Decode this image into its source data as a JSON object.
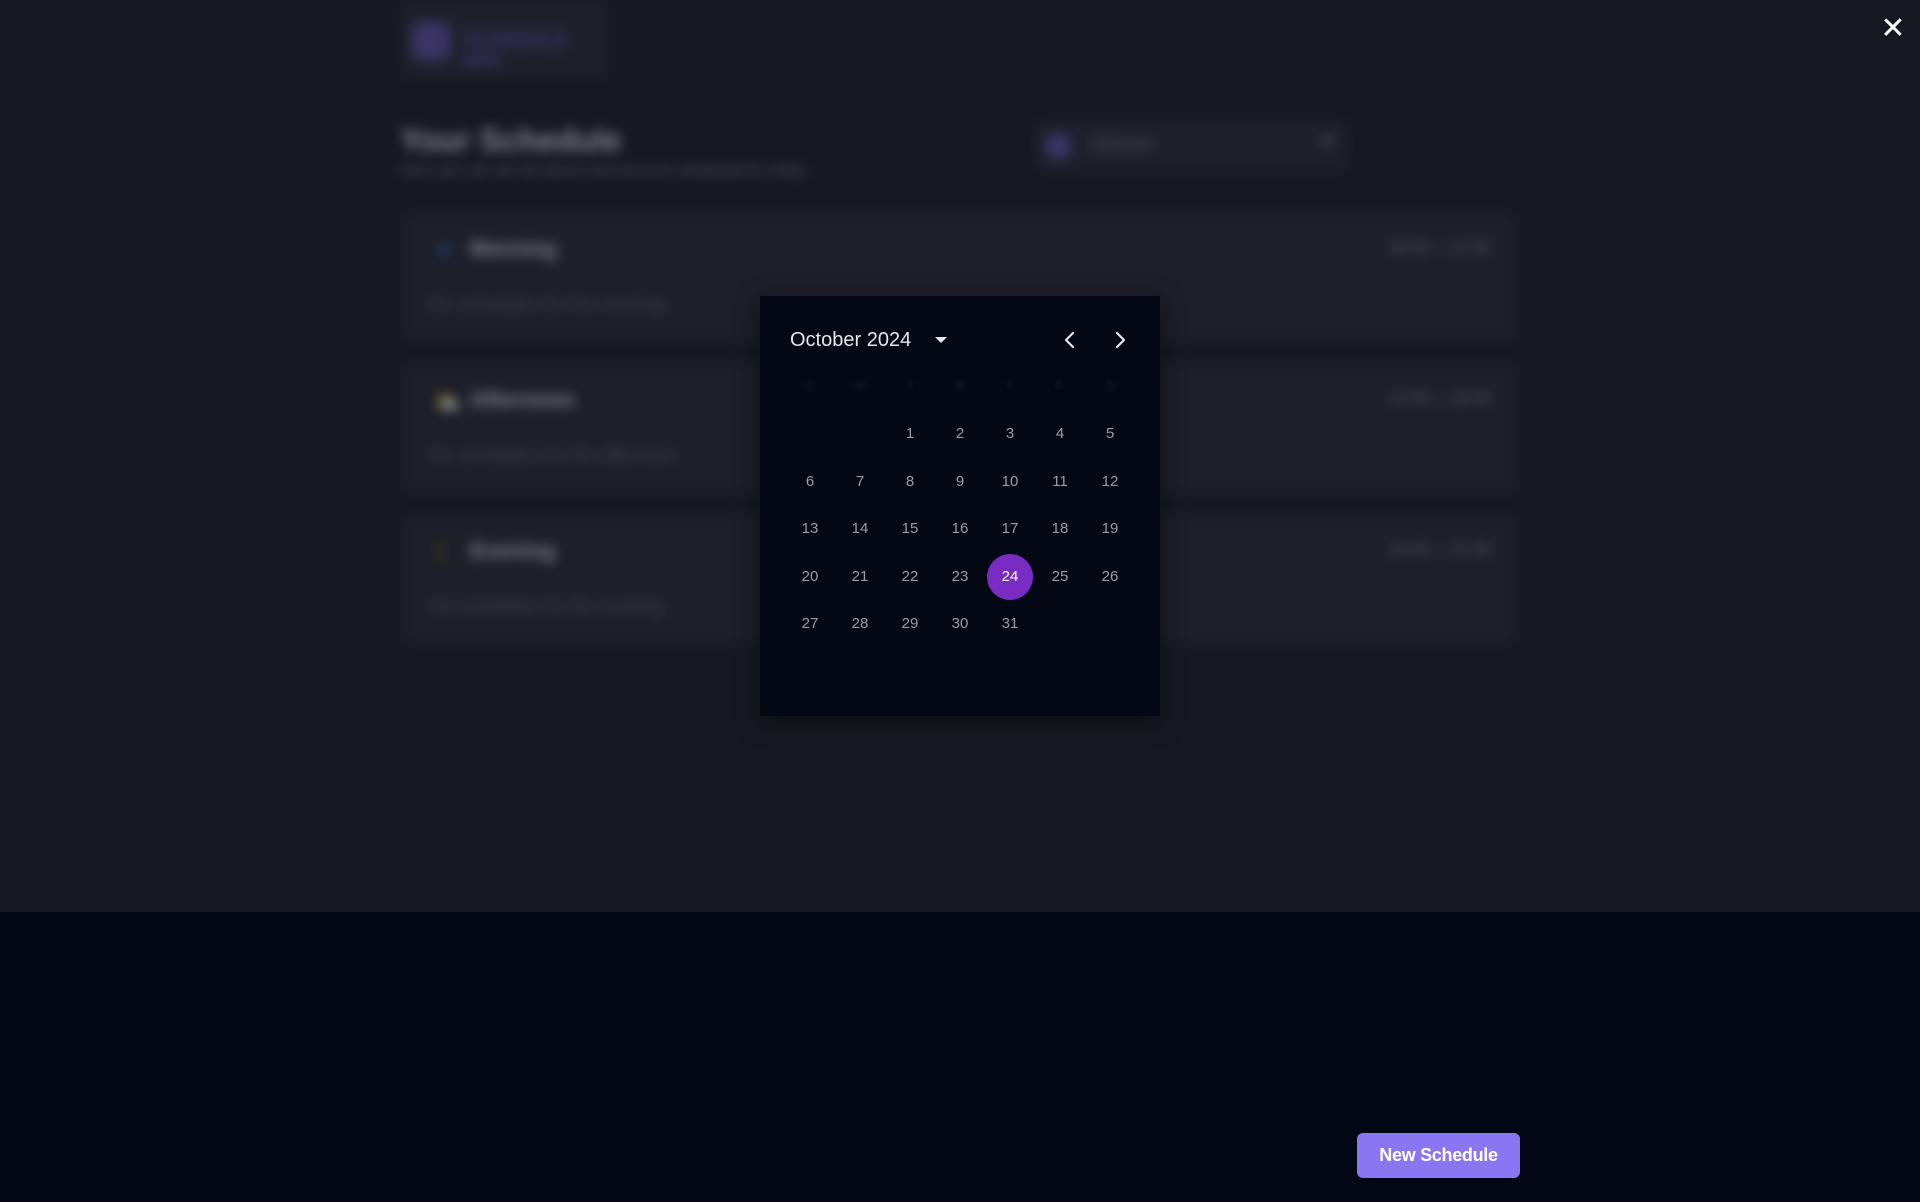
{
  "app": {
    "logo_text": "SCHEDULE APP"
  },
  "background": {
    "title": "Your Schedule",
    "subtitle": "Here you can see all clients and services scheduled for today",
    "filter_select": {
      "value": "Selected"
    },
    "slots": [
      {
        "name": "Morning",
        "icon": "sun-icon",
        "hours": "09:00 – 12:00",
        "empty_text": "No schedules for the morning"
      },
      {
        "name": "Afternoon",
        "icon": "cloud-sun-icon",
        "hours": "13:00 – 18:00",
        "empty_text": "No schedules for the afternoon"
      },
      {
        "name": "Evening",
        "icon": "moon-icon",
        "hours": "19:00 – 21:00",
        "empty_text": "No schedules for the evening"
      }
    ]
  },
  "close": {
    "icon": "close-icon",
    "glyph": "✕"
  },
  "datepicker": {
    "month_label": "October 2024",
    "weekdays": [
      "S",
      "M",
      "T",
      "W",
      "T",
      "F",
      "S"
    ],
    "first_weekday_index": 2,
    "days_in_month": 31,
    "selected_day": 24,
    "colors": {
      "selected": "#7a2bc2"
    }
  },
  "actions": {
    "new_schedule_label": "New Schedule",
    "accent_color": "#8a75f2"
  }
}
